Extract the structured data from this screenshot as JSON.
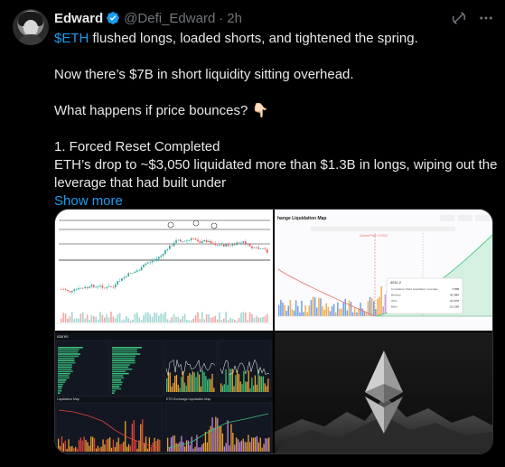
{
  "author": {
    "name": "Edward",
    "handle": "@Defi_Edward",
    "time": "2h"
  },
  "icons": {
    "verified": "verified-badge-icon",
    "grok": "grok-icon",
    "more": "more-options-icon"
  },
  "colors": {
    "accent": "#1d9bf0",
    "background": "#000000",
    "text": "#e7e9ea",
    "muted": "#71767b"
  },
  "tweet": {
    "line1_cashtag": "$ETH",
    "line1_rest": " flushed longs, loaded shorts, and tightened the spring.",
    "line2": "Now there’s $7B in short liquidity sitting overhead.",
    "line3": "What happens if price bounces? 👇🏻",
    "line4": "1. Forced Reset Completed",
    "line5": "ETH’s drop to ~$3,050 liquidated more than $1.3B in longs, wiping out the",
    "line6": "leverage that had built under",
    "show_more": "Show more"
  },
  "media": {
    "chart2_title": "hange Liquidation Map",
    "chart2_tooltip": {
      "price": "4011.2",
      "rows": [
        {
          "label": "Cumulative Short Liquidation Leverage",
          "value": "7.05B"
        },
        {
          "label": "Binance",
          "value": "40.38M"
        },
        {
          "label": "OKX",
          "value": "31.97M"
        },
        {
          "label": "Bybit",
          "value": "10.13M"
        }
      ]
    },
    "chart2_current_price": "Current Price: 3,200.2",
    "chart3_title": "utures",
    "chart3_panels": [
      "Liquidation Map",
      "ETH Exchange Liquidation Map"
    ]
  }
}
